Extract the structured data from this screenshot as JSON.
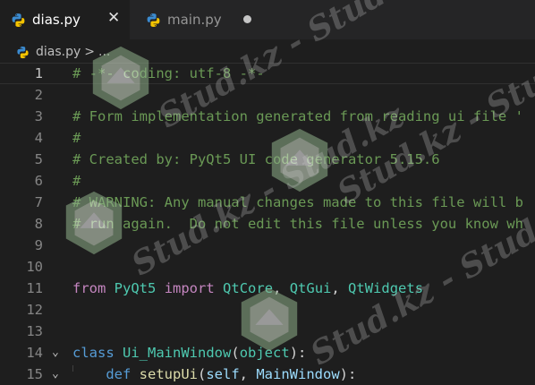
{
  "tabs": [
    {
      "label": "dias.py",
      "active": true,
      "close_glyph": "✕"
    },
    {
      "label": "main.py",
      "active": false,
      "modified": true
    }
  ],
  "breadcrumb": {
    "file": "dias.py",
    "separator": ">",
    "ellipsis": "..."
  },
  "editor": {
    "lines": [
      {
        "num": "1",
        "current": true,
        "segments": [
          {
            "c": "cm",
            "t": "# -*- coding: utf-8 -*-"
          }
        ]
      },
      {
        "num": "2",
        "segments": []
      },
      {
        "num": "3",
        "segments": [
          {
            "c": "cm",
            "t": "# Form implementation generated from reading ui file '"
          }
        ]
      },
      {
        "num": "4",
        "segments": [
          {
            "c": "cm",
            "t": "#"
          }
        ]
      },
      {
        "num": "5",
        "segments": [
          {
            "c": "cm",
            "t": "# Created by: PyQt5 UI code generator 5.15.6"
          }
        ]
      },
      {
        "num": "6",
        "segments": [
          {
            "c": "cm",
            "t": "#"
          }
        ]
      },
      {
        "num": "7",
        "segments": [
          {
            "c": "cm",
            "t": "# WARNING: Any manual changes made to this file will b"
          }
        ]
      },
      {
        "num": "8",
        "segments": [
          {
            "c": "cm",
            "t": "# run again.  Do not edit this file unless you know wh"
          }
        ]
      },
      {
        "num": "9",
        "segments": []
      },
      {
        "num": "10",
        "segments": []
      },
      {
        "num": "11",
        "segments": [
          {
            "c": "kw",
            "t": "from"
          },
          {
            "c": "plain",
            "t": " "
          },
          {
            "c": "cls",
            "t": "PyQt5"
          },
          {
            "c": "plain",
            "t": " "
          },
          {
            "c": "kw",
            "t": "import"
          },
          {
            "c": "plain",
            "t": " "
          },
          {
            "c": "cls",
            "t": "QtCore"
          },
          {
            "c": "plain",
            "t": ", "
          },
          {
            "c": "cls",
            "t": "QtGui"
          },
          {
            "c": "plain",
            "t": ", "
          },
          {
            "c": "cls",
            "t": "QtWidgets"
          }
        ]
      },
      {
        "num": "12",
        "segments": []
      },
      {
        "num": "13",
        "segments": []
      },
      {
        "num": "14",
        "fold": "⌄",
        "segments": [
          {
            "c": "def",
            "t": "class"
          },
          {
            "c": "plain",
            "t": " "
          },
          {
            "c": "cls",
            "t": "Ui_MainWindow"
          },
          {
            "c": "plain",
            "t": "("
          },
          {
            "c": "cls",
            "t": "object"
          },
          {
            "c": "plain",
            "t": "):"
          }
        ]
      },
      {
        "num": "15",
        "fold": "⌄",
        "segments": [
          {
            "c": "plain",
            "t": "    "
          },
          {
            "c": "def",
            "t": "def"
          },
          {
            "c": "plain",
            "t": " "
          },
          {
            "c": "fn",
            "t": "setupUi"
          },
          {
            "c": "plain",
            "t": "("
          },
          {
            "c": "param",
            "t": "self"
          },
          {
            "c": "plain",
            "t": ", "
          },
          {
            "c": "param",
            "t": "MainWindow"
          },
          {
            "c": "plain",
            "t": "):"
          }
        ]
      }
    ]
  },
  "watermark": {
    "text": "Stud.kz - Stud.kz",
    "icon": "stud-kz-seal-icon"
  },
  "colors": {
    "editor_bg": "#1e1e1e",
    "tabbar_bg": "#252526",
    "comment": "#6a9955",
    "keyword": "#c586c0",
    "class": "#4ec9b0",
    "storage": "#569cd6",
    "function": "#dcdcaa",
    "param": "#9cdcfe",
    "python_blue": "#3572A5",
    "python_yellow": "#FFD43B"
  }
}
